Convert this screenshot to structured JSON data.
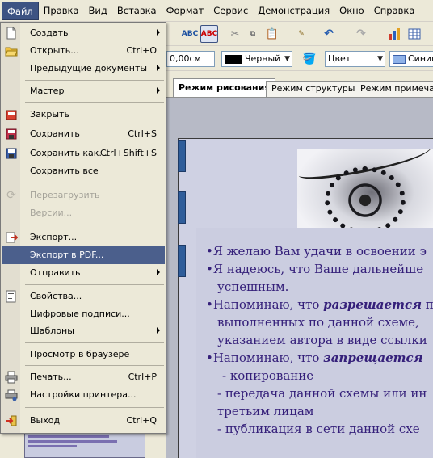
{
  "menubar": {
    "items": [
      "Файл",
      "Правка",
      "Вид",
      "Вставка",
      "Формат",
      "Сервис",
      "Демонстрация",
      "Окно",
      "Справка"
    ]
  },
  "toolbar2": {
    "line_width": "0,00см",
    "line_color": "Черный",
    "area_style": "Цвет",
    "area_color": "Синий"
  },
  "tabs": [
    "Режим рисования",
    "Режим структуры",
    "Режим примечани"
  ],
  "file_menu": {
    "items": [
      {
        "label": "Создать",
        "shortcut": "",
        "submenu": true,
        "icon": "new-document-icon"
      },
      {
        "label": "Открыть...",
        "shortcut": "Ctrl+O",
        "icon": "open-folder-icon"
      },
      {
        "label": "Предыдущие документы",
        "shortcut": "",
        "submenu": true,
        "icon": ""
      },
      {
        "label": "Мастер",
        "shortcut": "",
        "submenu": true,
        "icon": ""
      },
      {
        "label": "Закрыть",
        "shortcut": "",
        "icon": "close-document-icon"
      },
      {
        "label": "Сохранить",
        "shortcut": "Ctrl+S",
        "icon": "save-icon"
      },
      {
        "label": "Сохранить как...",
        "shortcut": "Ctrl+Shift+S",
        "icon": "save-as-icon"
      },
      {
        "label": "Сохранить все",
        "shortcut": "",
        "icon": ""
      },
      {
        "label": "Перезагрузить",
        "shortcut": "",
        "icon": "reload-icon",
        "disabled": true
      },
      {
        "label": "Версии...",
        "shortcut": "",
        "icon": "",
        "disabled": true
      },
      {
        "label": "Экспорт...",
        "shortcut": "",
        "icon": "export-icon"
      },
      {
        "label": "Экспорт в PDF...",
        "shortcut": "",
        "icon": "pdf-icon",
        "highlighted": true
      },
      {
        "label": "Отправить",
        "shortcut": "",
        "submenu": true,
        "icon": ""
      },
      {
        "label": "Свойства...",
        "shortcut": "",
        "icon": "properties-icon"
      },
      {
        "label": "Цифровые подписи...",
        "shortcut": "",
        "icon": ""
      },
      {
        "label": "Шаблоны",
        "shortcut": "",
        "submenu": true,
        "icon": ""
      },
      {
        "label": "Просмотр в браузере",
        "shortcut": "",
        "icon": ""
      },
      {
        "label": "Печать...",
        "shortcut": "Ctrl+P",
        "icon": "printer-icon"
      },
      {
        "label": "Настройки принтера...",
        "shortcut": "",
        "icon": "printer-settings-icon"
      },
      {
        "label": "Выход",
        "shortcut": "Ctrl+Q",
        "icon": "exit-icon"
      }
    ]
  },
  "slide": {
    "lines": [
      "•Я желаю Вам удачи в освоении э",
      "•Я надеюсь, что Ваше дальнейше",
      "  успешным.",
      "•Напоминаю, что ",
      "  выполненных по данной схеме,",
      "  указанием автора в виде ссылки",
      "•Напоминаю, что ",
      "     - копирование",
      "   - передача данной схемы или ин",
      "   третьим лицам",
      "   - публикация в сети  данной схе"
    ],
    "emph_allowed": "разрешается",
    "emph_allowed_tail": " п",
    "emph_forbidden": "запрещается"
  },
  "colors": {
    "menu_highlight": "#4b5f8c",
    "slide_text": "#35207a",
    "slide_bg": "#cfd1e3"
  }
}
